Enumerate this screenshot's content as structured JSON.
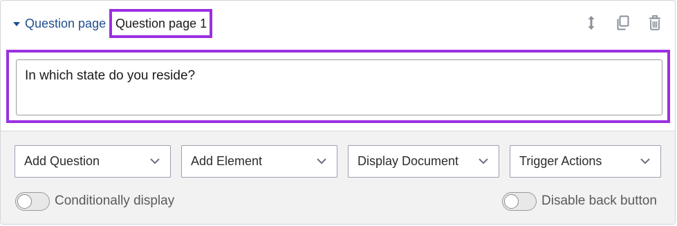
{
  "header": {
    "section_label": "Question page",
    "page_name": "Question page 1",
    "actions": [
      {
        "icon": "reorder-icon"
      },
      {
        "icon": "copy-icon"
      },
      {
        "icon": "trash-icon"
      }
    ]
  },
  "question": {
    "text": "In which state do you reside?"
  },
  "dropdowns": [
    {
      "label": "Add Question"
    },
    {
      "label": "Add Element"
    },
    {
      "label": "Display Document"
    },
    {
      "label": "Trigger Actions"
    }
  ],
  "toggles": {
    "conditional": {
      "label": "Conditionally display",
      "on": false
    },
    "back_button": {
      "label": "Disable back button",
      "on": false
    }
  },
  "colors": {
    "accent_focus": "#9b30e0",
    "link_blue": "#1f4e8f",
    "icon_gray": "#8a8f98"
  }
}
